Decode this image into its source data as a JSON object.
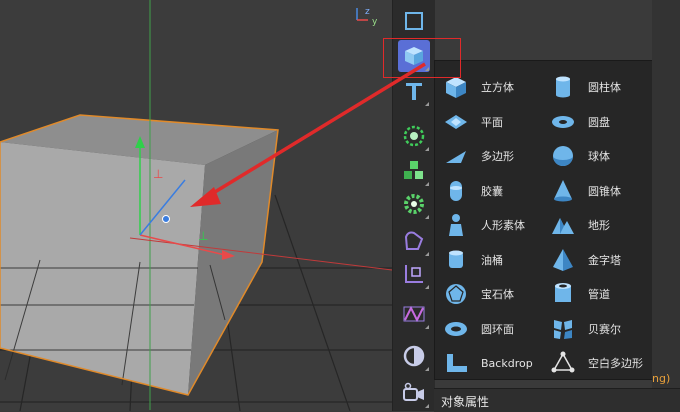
{
  "viewport": {
    "axis_gizmo": {
      "y_label": "y",
      "z_label": "z"
    }
  },
  "toolbar": {
    "items": [
      {
        "name": "rectangle-tool",
        "icon": "square-outline-icon"
      },
      {
        "name": "cube-tool",
        "icon": "cube-icon",
        "active": true
      },
      {
        "name": "text-tool",
        "icon": "text-T-icon"
      },
      {
        "name": "cloner-tool",
        "icon": "cloner-icon"
      },
      {
        "name": "mograph-tool",
        "icon": "cubes-cluster-icon"
      },
      {
        "name": "effector-tool",
        "icon": "gear-flower-icon"
      },
      {
        "name": "deformer-tool",
        "icon": "bend-deformer-icon"
      },
      {
        "name": "spline-tool",
        "icon": "axis-box-icon"
      },
      {
        "name": "fields-tool",
        "icon": "fields-icon"
      },
      {
        "name": "environment-tool",
        "icon": "sky-sphere-icon"
      },
      {
        "name": "camera-tool",
        "icon": "camera-icon"
      }
    ]
  },
  "menu": {
    "items": [
      {
        "label": "立方体",
        "icon": "cube-icon"
      },
      {
        "label": "圆柱体",
        "icon": "cylinder-icon"
      },
      {
        "label": "平面",
        "icon": "plane-icon"
      },
      {
        "label": "圆盘",
        "icon": "disc-icon"
      },
      {
        "label": "多边形",
        "icon": "polygon-icon"
      },
      {
        "label": "球体",
        "icon": "sphere-icon"
      },
      {
        "label": "胶囊",
        "icon": "capsule-icon"
      },
      {
        "label": "圆锥体",
        "icon": "cone-icon"
      },
      {
        "label": "人形素体",
        "icon": "figure-icon"
      },
      {
        "label": "地形",
        "icon": "landscape-icon"
      },
      {
        "label": "油桶",
        "icon": "oil-tank-icon"
      },
      {
        "label": "金字塔",
        "icon": "pyramid-icon"
      },
      {
        "label": "宝石体",
        "icon": "gem-icon"
      },
      {
        "label": "管道",
        "icon": "tube-icon"
      },
      {
        "label": "圆环面",
        "icon": "torus-icon"
      },
      {
        "label": "贝赛尔",
        "icon": "bezier-icon"
      },
      {
        "label": "Backdrop",
        "icon": "backdrop-icon"
      },
      {
        "label": "空白多边形",
        "icon": "empty-polygon-icon"
      }
    ]
  },
  "bottom": {
    "attributes_label": "对象属性",
    "partial_text": "ng)"
  },
  "colors": {
    "accent": "#5a6fd6",
    "icon_blue": "#6fb6ea",
    "annotation_red": "#e02a2a",
    "selection_orange": "#e08a2a"
  }
}
